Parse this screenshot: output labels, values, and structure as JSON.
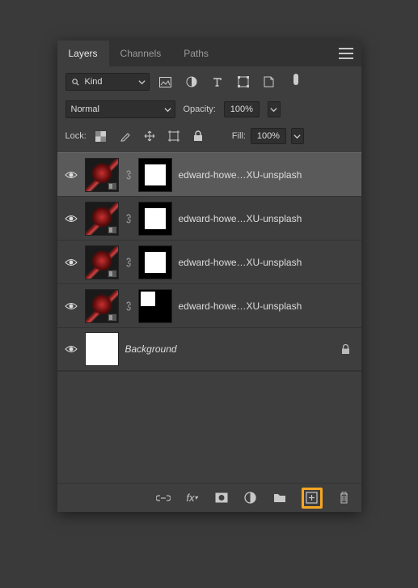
{
  "tabs": {
    "layers": "Layers",
    "channels": "Channels",
    "paths": "Paths"
  },
  "filter": {
    "kind_label": "Kind"
  },
  "blend": {
    "mode": "Normal",
    "opacity_label": "Opacity:",
    "opacity_value": "100%"
  },
  "lock": {
    "label": "Lock:",
    "fill_label": "Fill:",
    "fill_value": "100%"
  },
  "layers": [
    {
      "name": "edward-howe…XU-unsplash",
      "mask": "white",
      "selected": true
    },
    {
      "name": "edward-howe…XU-unsplash",
      "mask": "white",
      "selected": false
    },
    {
      "name": "edward-howe…XU-unsplash",
      "mask": "white",
      "selected": false
    },
    {
      "name": "edward-howe…XU-unsplash",
      "mask": "corner",
      "selected": false
    }
  ],
  "background": {
    "name": "Background"
  }
}
